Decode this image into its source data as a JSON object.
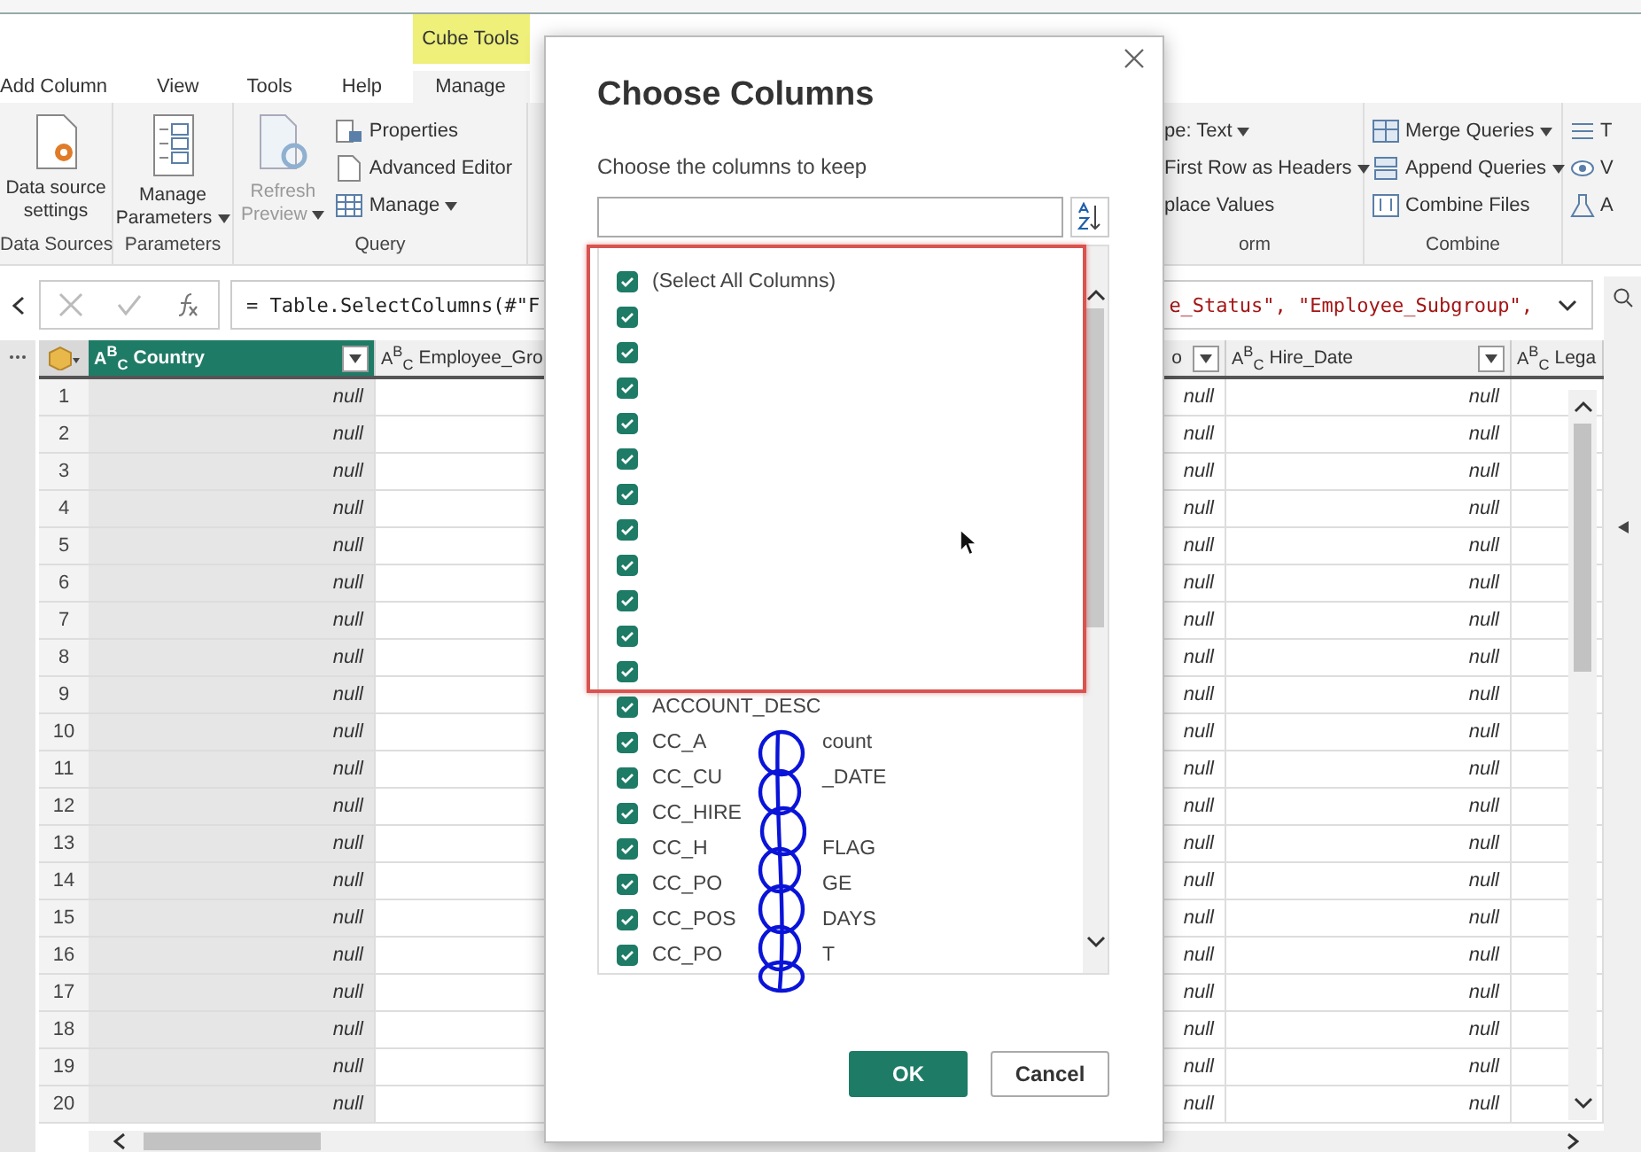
{
  "ribbon": {
    "context_tab": {
      "label": "Cube Tools"
    },
    "tabs": [
      {
        "label": "Add Column",
        "selected": false
      },
      {
        "label": "View",
        "selected": false
      },
      {
        "label": "Tools",
        "selected": false
      },
      {
        "label": "Help",
        "selected": false
      },
      {
        "label": "Manage",
        "selected": true
      }
    ],
    "groups": [
      {
        "label": "Data Sources",
        "large": [
          {
            "lines": [
              "Data source",
              "settings"
            ],
            "dropdown": false,
            "disabled": false
          }
        ]
      },
      {
        "label": "Parameters",
        "large": [
          {
            "lines": [
              "Manage",
              "Parameters"
            ],
            "dropdown": true,
            "disabled": false
          }
        ]
      },
      {
        "label": "Query",
        "large": [
          {
            "lines": [
              "Refresh",
              "Preview"
            ],
            "dropdown": true,
            "disabled": true
          }
        ],
        "small": [
          {
            "label": "Properties",
            "dropdown": false
          },
          {
            "label": "Advanced Editor",
            "dropdown": false
          },
          {
            "label": "Manage",
            "dropdown": true
          }
        ]
      },
      {
        "label": "orm",
        "small": [
          {
            "label": "pe: Text",
            "dropdown": true
          },
          {
            "label": "First Row as Headers",
            "dropdown": true
          },
          {
            "label": "place Values",
            "dropdown": false
          }
        ]
      },
      {
        "label": "Combine",
        "small": [
          {
            "label": "Merge Queries",
            "dropdown": true
          },
          {
            "label": "Append Queries",
            "dropdown": true
          },
          {
            "label": "Combine Files",
            "dropdown": false
          }
        ]
      },
      {
        "small": [
          {
            "label": "T",
            "dropdown": false
          },
          {
            "label": "V",
            "dropdown": false
          },
          {
            "label": "A",
            "dropdown": false
          }
        ]
      }
    ]
  },
  "formula": {
    "left": "= Table.SelectColumns(#\"F",
    "right": "e_Status\", \"Employee_Subgroup\","
  },
  "grid": {
    "columns": [
      {
        "label": "Country",
        "type": "A$^{B}$$_{C}$",
        "selected": true,
        "kind": "data"
      },
      {
        "label": "Employee_Gro",
        "type": "A$^{B}$$_{C}$",
        "selected": false,
        "kind": "blank"
      },
      {
        "label": "o",
        "selected": false,
        "kind": "data"
      },
      {
        "label": "Hire_Date",
        "type": "A$^{B}$$_{C}$",
        "selected": false,
        "kind": "data"
      },
      {
        "label": "Lega",
        "type": "A$^{B}$$_{C}$",
        "selected": false,
        "kind": "blank"
      }
    ],
    "rows": [
      {
        "number": "1",
        "values": [
          "null",
          "null",
          "null"
        ]
      },
      {
        "number": "2",
        "values": [
          "null",
          "null",
          "null"
        ]
      },
      {
        "number": "3",
        "values": [
          "null",
          "null",
          "null"
        ]
      },
      {
        "number": "4",
        "values": [
          "null",
          "null",
          "null"
        ]
      },
      {
        "number": "5",
        "values": [
          "null",
          "null",
          "null"
        ]
      },
      {
        "number": "6",
        "values": [
          "null",
          "null",
          "null"
        ]
      },
      {
        "number": "7",
        "values": [
          "null",
          "null",
          "null"
        ]
      },
      {
        "number": "8",
        "values": [
          "null",
          "null",
          "null"
        ]
      },
      {
        "number": "9",
        "values": [
          "null",
          "null",
          "null"
        ]
      },
      {
        "number": "10",
        "values": [
          "null",
          "null",
          "null"
        ]
      },
      {
        "number": "11",
        "values": [
          "null",
          "null",
          "null"
        ]
      },
      {
        "number": "12",
        "values": [
          "null",
          "null",
          "null"
        ]
      },
      {
        "number": "13",
        "values": [
          "null",
          "null",
          "null"
        ]
      },
      {
        "number": "14",
        "values": [
          "null",
          "null",
          "null"
        ]
      },
      {
        "number": "15",
        "values": [
          "null",
          "null",
          "null"
        ]
      },
      {
        "number": "16",
        "values": [
          "null",
          "null",
          "null"
        ]
      },
      {
        "number": "17",
        "values": [
          "null",
          "null",
          "null"
        ]
      },
      {
        "number": "18",
        "values": [
          "null",
          "null",
          "null"
        ]
      },
      {
        "number": "19",
        "values": [
          "null",
          "null",
          "null"
        ]
      },
      {
        "number": "20",
        "values": [
          "null",
          "null",
          "null"
        ]
      }
    ]
  },
  "dialog": {
    "title": "Choose Columns",
    "prompt": "Choose the columns to keep",
    "columns": [
      {
        "label": "(Select All Columns)",
        "checked": true
      },
      {
        "checked": true
      },
      {
        "checked": true
      },
      {
        "checked": true
      },
      {
        "checked": true
      },
      {
        "checked": true
      },
      {
        "checked": true
      },
      {
        "checked": true
      },
      {
        "checked": true
      },
      {
        "checked": true
      },
      {
        "checked": true
      },
      {
        "checked": true
      },
      {
        "label": "ACCOUNT_DESC",
        "checked": true
      },
      {
        "label": "CC_A",
        "tail": "count",
        "checked": true
      },
      {
        "label": "CC_CU",
        "tail": "_DATE",
        "checked": true
      },
      {
        "label": "CC_HIRE",
        "checked": true
      },
      {
        "label": "CC_H",
        "tail": "FLAG",
        "checked": true
      },
      {
        "label": "CC_PO",
        "tail": "GE",
        "checked": true
      },
      {
        "label": "CC_POS",
        "tail": "DAYS",
        "checked": true
      },
      {
        "label": "CC_PO",
        "tail": "T",
        "checked": true
      }
    ],
    "buttons": [
      {
        "label": "OK",
        "kind": "primary"
      },
      {
        "label": "Cancel",
        "kind": "secondary"
      }
    ]
  }
}
